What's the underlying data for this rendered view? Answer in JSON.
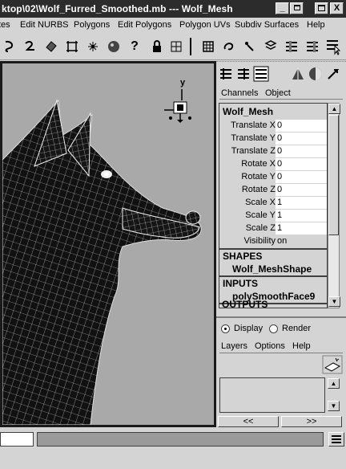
{
  "window": {
    "title": "ktop\\02\\Wolf_Furred_Smoothed.mb  ---  Wolf_Mesh",
    "buttons": [
      "_",
      "□",
      "X"
    ]
  },
  "menubar": {
    "items": [
      "tes",
      "Edit NURBS",
      "Polygons",
      "Edit Polygons",
      "Polygon UVs",
      "Subdiv Surfaces",
      "Help"
    ]
  },
  "shelf": {
    "icons": [
      "lasso-icon",
      "curve-icon",
      "mesh-icon",
      "lattice-icon",
      "sparkle-icon",
      "sphere-icon",
      "help-icon",
      "lock-icon",
      "grid-icon",
      "divider-icon",
      "grid-box-icon",
      "link-icon",
      "blend-icon",
      "script-icon",
      "list-icon",
      "list-icon-2"
    ]
  },
  "viewport": {
    "axis_label": "y"
  },
  "channel_box": {
    "tabs": [
      "Channels",
      "Object"
    ],
    "object_name": "Wolf_Mesh",
    "attributes": [
      {
        "label": "Translate X",
        "value": "0"
      },
      {
        "label": "Translate Y",
        "value": "0"
      },
      {
        "label": "Translate Z",
        "value": "0"
      },
      {
        "label": "Rotate X",
        "value": "0"
      },
      {
        "label": "Rotate Y",
        "value": "0"
      },
      {
        "label": "Rotate Z",
        "value": "0"
      },
      {
        "label": "Scale X",
        "value": "1"
      },
      {
        "label": "Scale Y",
        "value": "1"
      },
      {
        "label": "Scale Z",
        "value": "1"
      },
      {
        "label": "Visibility",
        "value": "on"
      }
    ],
    "shapes_header": "SHAPES",
    "shape_name": "Wolf_MeshShape",
    "inputs_header": "INPUTS",
    "input_name": "polySmoothFace9",
    "outputs_header": "OUTPUTS"
  },
  "layer_editor": {
    "display_label": "Display",
    "render_label": "Render",
    "menu": [
      "Layers",
      "Options",
      "Help"
    ],
    "nav_prev": "<<",
    "nav_next": ">>"
  },
  "colors": {
    "ui_gray": "#d4d4d4",
    "viewport_bg": "#a9a9a9",
    "titlebar": "#2c2c2c"
  }
}
